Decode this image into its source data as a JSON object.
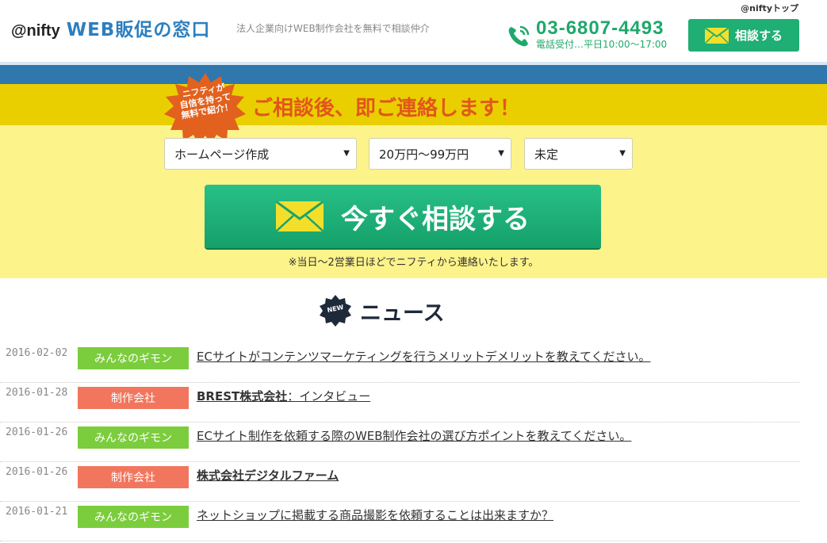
{
  "header": {
    "brand": "@nifty",
    "site_name": "WEB販促の窓口",
    "tagline": "法人企業向けWEB制作会社を無料で相談仲介",
    "top_link": "@niftyトップ",
    "phone": "03-6807-4493",
    "hours": "電話受付…平日10:00〜17:00",
    "consult_button": "相談する"
  },
  "banner": {
    "burst_lines": [
      "ニフティが",
      "自信を持って",
      "無料で紹介！"
    ],
    "headline": "ご相談後、即ご連絡します！",
    "selects": [
      {
        "value": "ホームページ作成"
      },
      {
        "value": "20万円〜99万円"
      },
      {
        "value": "未定"
      }
    ],
    "cta_label": "今すぐ相談する",
    "note": "※当日〜2営業日ほどでニフティから連絡いたします。",
    "colors": {
      "accent_green": "#1fae73",
      "headline_orange": "#e2561b",
      "blue_bar": "#2f77ad",
      "yellow": "#e9cf00"
    }
  },
  "news": {
    "badge": "NEW",
    "title": "ニュース",
    "items": [
      {
        "date": "2016-02-02",
        "tag": "みんなのギモン",
        "tag_color": "#7ccd3d",
        "title_bold": "",
        "title": "ECサイトがコンテンツマーケティングを行うメリットデメリットを教えてください。"
      },
      {
        "date": "2016-01-28",
        "tag": "制作会社",
        "tag_color": "#f2765d",
        "title_bold": "BREST株式会社",
        "title": "：インタビュー"
      },
      {
        "date": "2016-01-26",
        "tag": "みんなのギモン",
        "tag_color": "#7ccd3d",
        "title_bold": "",
        "title": "ECサイト制作を依頼する際のWEB制作会社の選び方ポイントを教えてください。"
      },
      {
        "date": "2016-01-26",
        "tag": "制作会社",
        "tag_color": "#f2765d",
        "title_bold": "株式会社デジタルファーム",
        "title": ""
      },
      {
        "date": "2016-01-21",
        "tag": "みんなのギモン",
        "tag_color": "#7ccd3d",
        "title_bold": "",
        "title": "ネットショップに掲載する商品撮影を依頼することは出来ますか？"
      }
    ]
  }
}
